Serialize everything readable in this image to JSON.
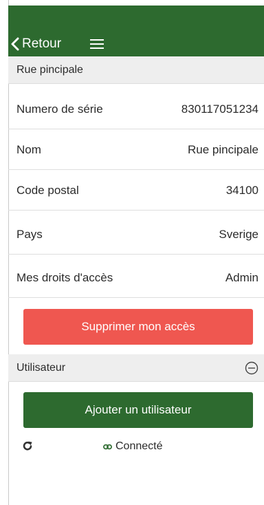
{
  "header": {
    "back_label": "Retour",
    "back_icon": "chevron-left-icon",
    "menu_icon": "hamburger-menu-icon",
    "background_color": "#2d6a2f"
  },
  "site_section": {
    "title": "Rue pincipale"
  },
  "details": [
    {
      "label": "Numero de série",
      "value": "830117051234"
    },
    {
      "label": "Nom",
      "value": "Rue pincipale"
    },
    {
      "label": "Code postal",
      "value": "34100"
    },
    {
      "label": "Pays",
      "value": "Sverige"
    },
    {
      "label": "Mes droits d'accès",
      "value": "Admin"
    }
  ],
  "actions": {
    "remove_access_label": "Supprimer mon accès",
    "remove_access_color": "#ef5750"
  },
  "users_section": {
    "title": "Utilisateur",
    "collapse_icon": "minus-circle-icon",
    "add_user_label": "Ajouter un utilisateur",
    "add_user_color": "#2d6a2f"
  },
  "footer": {
    "refresh_icon": "refresh-icon",
    "status_icon": "link-icon",
    "status_text": "Connecté"
  }
}
